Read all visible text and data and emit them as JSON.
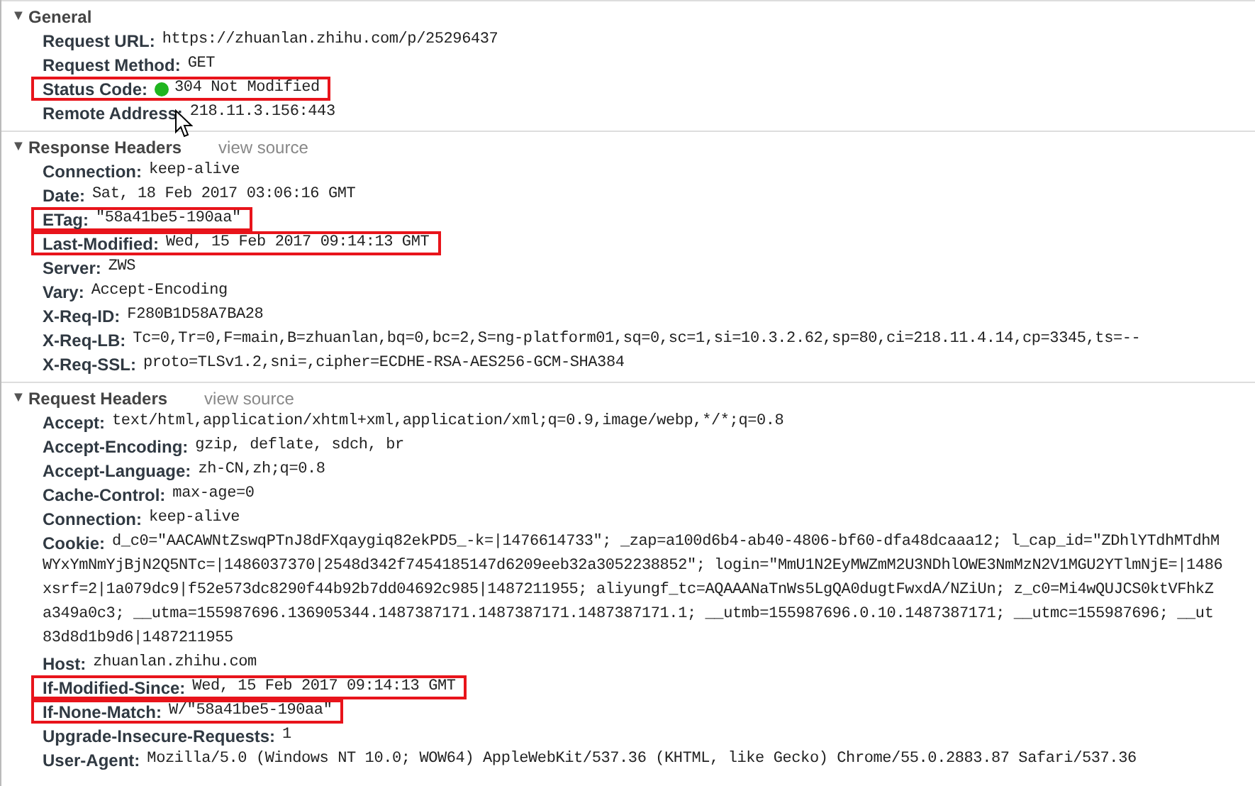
{
  "sections": [
    {
      "toggle": "▼",
      "title": "General",
      "expanded": true,
      "rows": [
        {
          "name": "Request URL:",
          "value": "https://zhuanlan.zhihu.com/p/25296437",
          "highlighted": false
        },
        {
          "name": "Request Method:",
          "value": "GET",
          "highlighted": false
        },
        {
          "name": "Status Code:",
          "value": "304 Not Modified",
          "highlighted": true
        },
        {
          "name": "Remote Address:",
          "value": "218.11.3.156:443",
          "highlighted": false,
          "cursor": true
        }
      ]
    },
    {
      "toggle": "▼",
      "title": "Response Headers",
      "expanded": true,
      "link": "view source",
      "rows": [
        {
          "name": "Connection:",
          "value": "keep-alive",
          "highlighted": false
        },
        {
          "name": "Date:",
          "value": "Sat, 18 Feb 2017 03:06:16 GMT",
          "highlighted": false
        },
        {
          "name": "ETag:",
          "value": "\"58a41be5-190aa\"",
          "highlighted": true
        },
        {
          "name": "Last-Modified:",
          "value": "Wed, 15 Feb 2017 09:14:13 GMT",
          "highlighted": true
        },
        {
          "name": "Server:",
          "value": "ZWS",
          "highlighted": false
        },
        {
          "name": "Vary:",
          "value": "Accept-Encoding",
          "highlighted": false
        },
        {
          "name": "X-Req-ID:",
          "value": "F280B1D58A7BA28",
          "highlighted": false
        },
        {
          "name": "X-Req-LB:",
          "value": "Tc=0,Tr=0,F=main,B=zhuanlan,bq=0,bc=2,S=ng-platform01,sq=0,sc=1,si=10.3.2.62,sp=80,ci=218.11.4.14,cp=3345,ts=--",
          "highlighted": false
        },
        {
          "name": "X-Req-SSL:",
          "value": "proto=TLSv1.2,sni=,cipher=ECDHE-RSA-AES256-GCM-SHA384",
          "highlighted": false
        }
      ]
    },
    {
      "toggle": "▼",
      "title": "Request Headers",
      "expanded": true,
      "link": "view source",
      "rows": [
        {
          "name": "Accept:",
          "value": "text/html,application/xhtml+xml,application/xml;q=0.9,image/webp,*/*;q=0.8",
          "highlighted": false
        },
        {
          "name": "Accept-Encoding:",
          "value": "gzip, deflate, sdch, br",
          "highlighted": false
        },
        {
          "name": "Accept-Language:",
          "value": "zh-CN,zh;q=0.8",
          "highlighted": false
        },
        {
          "name": "Cache-Control:",
          "value": "max-age=0",
          "highlighted": false
        },
        {
          "name": "Connection:",
          "value": "keep-alive",
          "highlighted": false
        },
        {
          "name": "Cookie:",
          "value": "d_c0=\"AACAWNtZswqPTnJ8dFXqaygiq82ekPD5_-k=|1476614733\"; _zap=a100d6b4-ab40-4806-bf60-dfa48dcaaa12; l_cap_id=\"ZDhlYTdhMTdhM",
          "highlighted": false,
          "continuation": [
            "WYxYmNmYjBjN2Q5NTc=|1486037370|2548d342f7454185147d6209eeb32a3052238852\"; login=\"MmU1N2EyMWZmM2U3NDhlOWE3NmMzN2V1MGU2YTlmNjE=|1486",
            "xsrf=2|1a079dc9|f52e573dc8290f44b92b7dd04692c985|1487211955; aliyungf_tc=AQAAANaTnWs5LgQA0dugtFwxdA/NZiUn; z_c0=Mi4wQUJCS0ktVFhkZ",
            "a349a0c3; __utma=155987696.136905344.1487387171.1487387171.1487387171.1; __utmb=155987696.0.10.1487387171; __utmc=155987696; __ut",
            "83d8d1b9d6|1487211955"
          ]
        },
        {
          "name": "Host:",
          "value": "zhuanlan.zhihu.com",
          "highlighted": false
        },
        {
          "name": "If-Modified-Since:",
          "value": "Wed, 15 Feb 2017 09:14:13 GMT",
          "highlighted": true
        },
        {
          "name": "If-None-Match:",
          "value": "W/\"58a41be5-190aa\"",
          "highlighted": true
        },
        {
          "name": "Upgrade-Insecure-Requests:",
          "value": "1",
          "highlighted": false
        },
        {
          "name": "User-Agent:",
          "value": "Mozilla/5.0 (Windows NT 10.0; WOW64) AppleWebKit/537.36 (KHTML, like Gecko) Chrome/55.0.2883.87 Safari/537.36",
          "highlighted": false
        }
      ]
    }
  ]
}
